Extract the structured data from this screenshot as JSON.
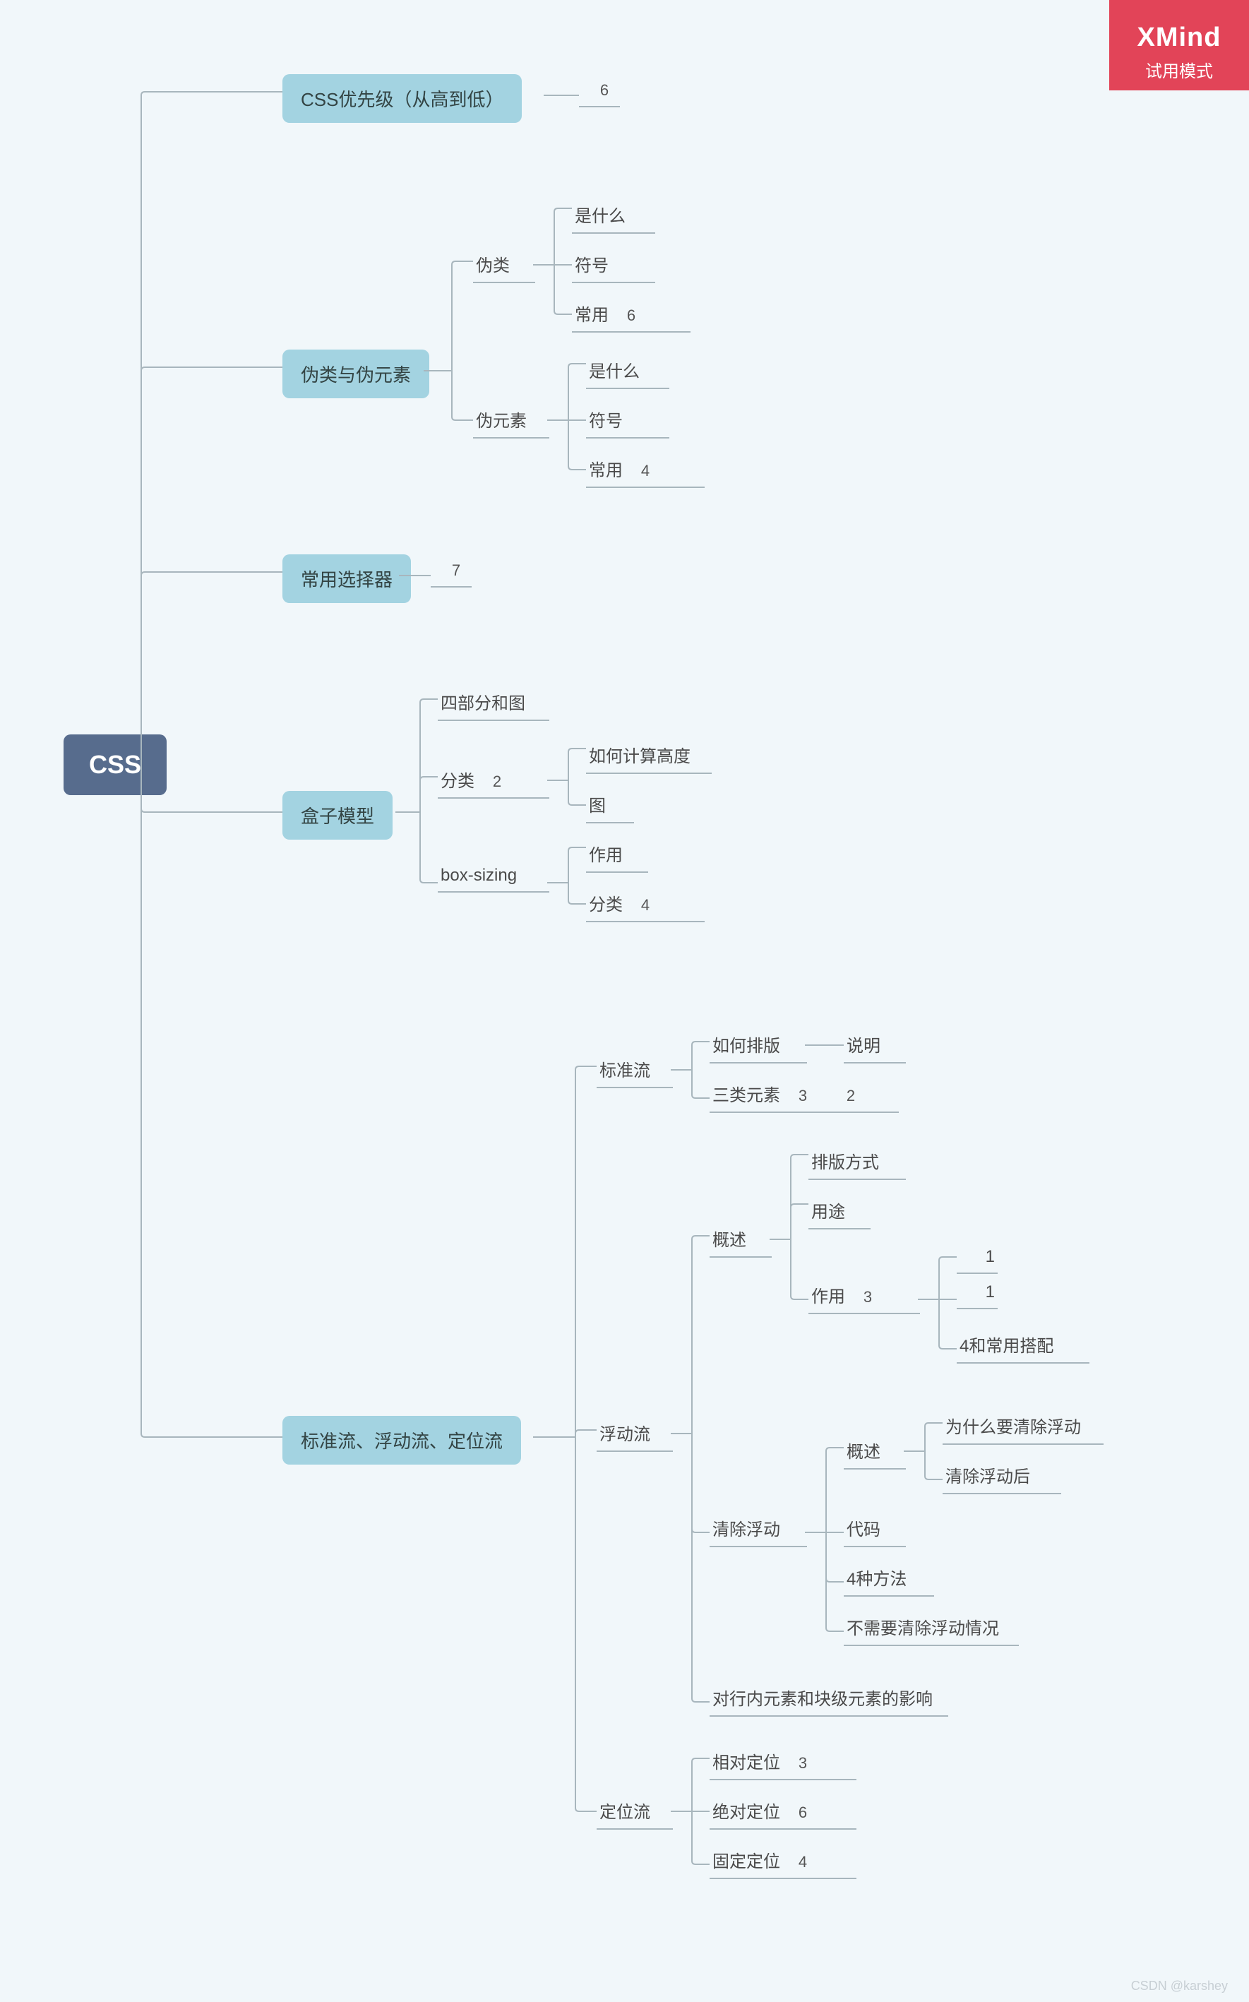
{
  "watermark": {
    "logo": "XMind",
    "subtitle": "试用模式"
  },
  "root": "CSS",
  "t1": {
    "label": "CSS优先级（从高到低）",
    "badge": "6"
  },
  "t2": {
    "label": "伪类与伪元素",
    "c1": {
      "label": "伪类",
      "g1": "是什么",
      "g2": "符号",
      "g3": {
        "label": "常用",
        "badge": "6"
      }
    },
    "c2": {
      "label": "伪元素",
      "g1": "是什么",
      "g2": "符号",
      "g3": {
        "label": "常用",
        "badge": "4"
      }
    }
  },
  "t3": {
    "label": "常用选择器",
    "badge": "7"
  },
  "t4": {
    "label": "盒子模型",
    "c1": "四部分和图",
    "c2": {
      "label": "分类",
      "badge": "2",
      "g1": "如何计算高度",
      "g2": "图"
    },
    "c3": {
      "label": "box-sizing",
      "g1": "作用",
      "g2": {
        "label": "分类",
        "badge": "4"
      }
    }
  },
  "t5": {
    "label": "标准流、浮动流、定位流",
    "std": {
      "label": "标准流",
      "g1": {
        "label": "如何排版",
        "sub": "说明"
      },
      "g2": {
        "label": "三类元素",
        "badge1": "3",
        "badge2": "2"
      }
    },
    "float": {
      "label": "浮动流",
      "ov": {
        "label": "概述",
        "g1": "排版方式",
        "g2": "用途",
        "g3": {
          "label": "作用",
          "badge": "3",
          "s1": "1",
          "s2": "1",
          "s3": "4和常用搭配"
        }
      },
      "clear": {
        "label": "清除浮动",
        "ov": {
          "label": "概述",
          "g1": "为什么要清除浮动",
          "g2": "清除浮动后"
        },
        "g1": "代码",
        "g2": "4种方法",
        "g3": "不需要清除浮动情况"
      },
      "impact": "对行内元素和块级元素的影响"
    },
    "pos": {
      "label": "定位流",
      "g1": {
        "label": "相对定位",
        "badge": "3"
      },
      "g2": {
        "label": "绝对定位",
        "badge": "6"
      },
      "g3": {
        "label": "固定定位",
        "badge": "4"
      }
    }
  },
  "credit": "CSDN @karshey"
}
